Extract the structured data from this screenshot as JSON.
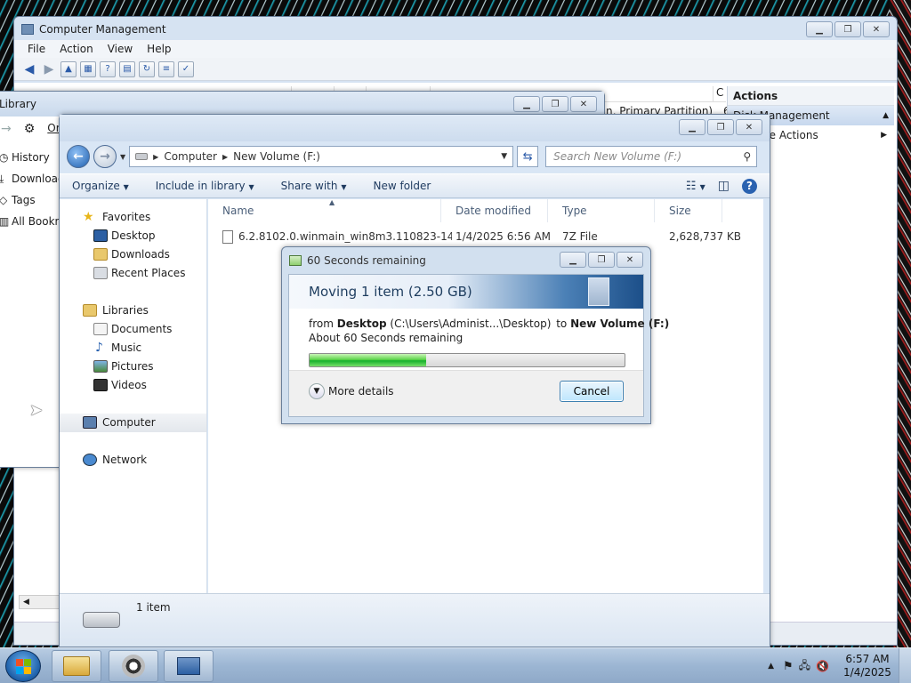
{
  "computer_management": {
    "title": "Computer Management",
    "menu": [
      "File",
      "Action",
      "View",
      "Help"
    ],
    "partition_text": "n, Primary Partition)",
    "partition_col": "6.",
    "col_c": "C",
    "actions_title": "Actions",
    "actions_sub": "Disk Management",
    "more_actions": "re Actions"
  },
  "library": {
    "title": "Library",
    "items": [
      "History",
      "Downloads",
      "Tags",
      "All Bookm"
    ],
    "org": "Or"
  },
  "explorer": {
    "breadcrumb": [
      "Computer",
      "New Volume (F:)"
    ],
    "search_placeholder": "Search New Volume (F:)",
    "commands": [
      "Organize",
      "Include in library",
      "Share with",
      "New folder"
    ],
    "nav": {
      "favorites_header": "Favorites",
      "favorites": [
        "Desktop",
        "Downloads",
        "Recent Places"
      ],
      "libraries_header": "Libraries",
      "libraries": [
        "Documents",
        "Music",
        "Pictures",
        "Videos"
      ],
      "computer": "Computer",
      "network": "Network"
    },
    "columns": [
      "Name",
      "Date modified",
      "Type",
      "Size"
    ],
    "file": {
      "name": "6.2.8102.0.winmain_win8m3.110823-1455...",
      "date": "1/4/2025 6:56 AM",
      "type": "7Z File",
      "size": "2,628,737 KB"
    },
    "status_count": "1 item"
  },
  "dialog": {
    "title": "60 Seconds remaining",
    "heading": "Moving 1 item (2.50 GB)",
    "from_label": "from",
    "from_bold": "Desktop",
    "from_path": "(C:\\Users\\Administ...\\Desktop)",
    "to_label": "to",
    "to_bold": "New Volume (F:)",
    "remaining": "About 60 Seconds remaining",
    "progress": 0.37,
    "more_details": "More details",
    "cancel": "Cancel"
  },
  "taskbar": {
    "time": "6:57 AM",
    "date": "1/4/2025"
  },
  "colors": {
    "accent": "#1f5fae",
    "progress_green": "#16b02c"
  }
}
